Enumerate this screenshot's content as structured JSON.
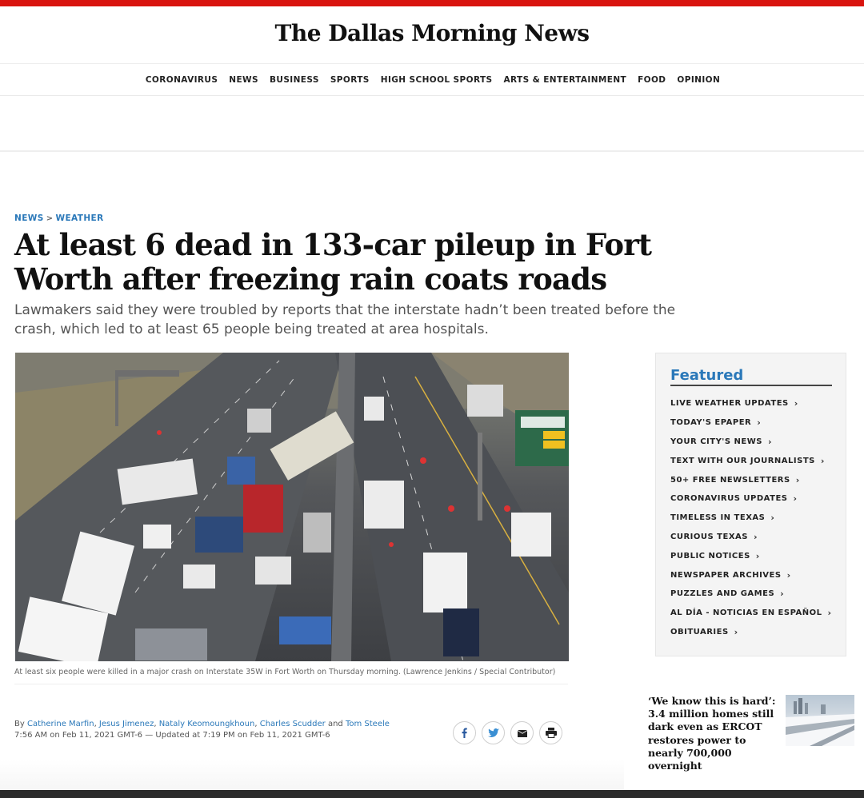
{
  "masthead": {
    "logo_text": "The Dallas Morning News"
  },
  "nav": {
    "items": [
      "CORONAVIRUS",
      "NEWS",
      "BUSINESS",
      "SPORTS",
      "HIGH SCHOOL SPORTS",
      "ARTS & ENTERTAINMENT",
      "FOOD",
      "OPINION"
    ]
  },
  "breadcrumb": {
    "section": "NEWS",
    "separator": ">",
    "subsection": "WEATHER"
  },
  "article": {
    "headline": "At least 6 dead in 133-car pileup in Fort Worth after freezing rain coats roads",
    "dek": "Lawmakers said they were troubled by reports that the interstate hadn’t been treated before the crash, which led to at least 65 people being treated at area hospitals.",
    "caption": "At least six people were killed in a major crash on Interstate 35W in Fort Worth on Thursday morning. (Lawrence Jenkins / Special Contributor)",
    "byline": {
      "prefix": "By",
      "authors": [
        "Catherine Marfin",
        "Jesus Jimenez",
        "Nataly Keomoungkhoun",
        "Charles Scudder"
      ],
      "conjunction": "and",
      "last_author": "Tom Steele",
      "timestamp": "7:56 AM on Feb 11, 2021 GMT-6 — Updated at 7:19 PM on Feb 11, 2021 GMT-6"
    },
    "share_icons": [
      "facebook-icon",
      "twitter-icon",
      "email-icon",
      "print-icon"
    ]
  },
  "featured": {
    "title": "Featured",
    "items": [
      "LIVE WEATHER UPDATES",
      "TODAY'S EPAPER",
      "YOUR CITY'S NEWS",
      "TEXT WITH OUR JOURNALISTS",
      "50+ FREE NEWSLETTERS",
      "CORONAVIRUS UPDATES",
      "TIMELESS IN TEXAS",
      "CURIOUS TEXAS",
      "PUBLIC NOTICES",
      "NEWSPAPER ARCHIVES",
      "PUZZLES AND GAMES",
      "AL DÍA - NOTICIAS EN ESPAÑOL",
      "OBITUARIES"
    ],
    "chevron": "›"
  },
  "related_story": {
    "headline": "‘We know this is hard’: 3.4 million homes still dark even as ERCOT restores power to nearly 700,000 overnight"
  },
  "colors": {
    "brand_red": "#d9140f",
    "link_blue": "#2a78b9"
  }
}
